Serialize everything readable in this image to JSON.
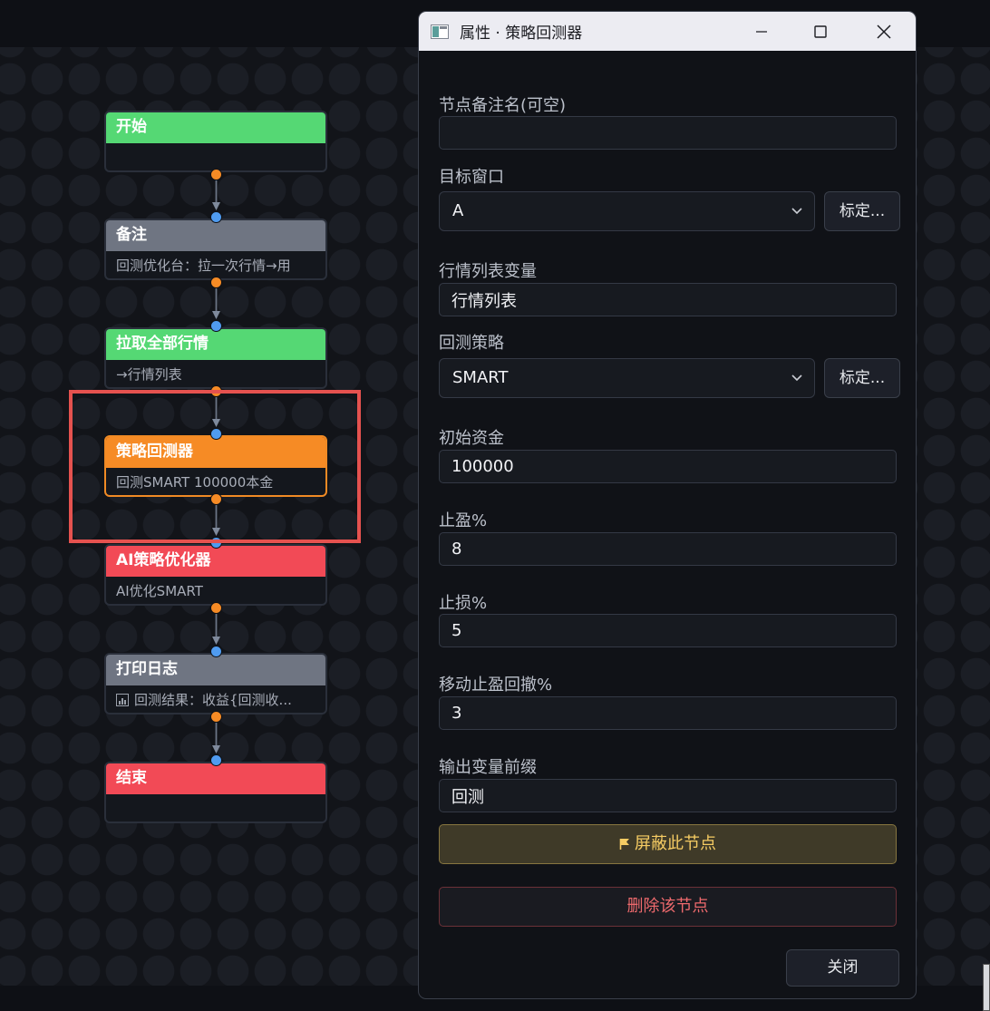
{
  "canvas": {
    "nodes": [
      {
        "title": "开始",
        "subtitle": "",
        "header_color": "#55d874"
      },
      {
        "title": "备注",
        "subtitle": "回测优化台：拉一次行情→用",
        "header_color": "#6f7582"
      },
      {
        "title": "拉取全部行情",
        "subtitle": "→行情列表",
        "header_color": "#55d874"
      },
      {
        "title": "策略回测器",
        "subtitle": "回测SMART 100000本金",
        "header_color": "#f68b25",
        "selected": true
      },
      {
        "title": "AI策略优化器",
        "subtitle": "AI优化SMART",
        "header_color": "#f24a56"
      },
      {
        "title": "打印日志",
        "subtitle": "回测结果：收益{回测收...",
        "subtitle_icon": "bar-chart-icon",
        "header_color": "#6f7582"
      },
      {
        "title": "结束",
        "subtitle": "",
        "header_color": "#f24a56"
      }
    ],
    "colors": {
      "out_port": "#f68b25",
      "in_port": "#4f9bf0",
      "highlight": "#e5524f"
    }
  },
  "dialog": {
    "title": "属性 · 策略回测器",
    "fields": {
      "note_label": "节点备注名(可空)",
      "note_value": "",
      "target_window_label": "目标窗口",
      "target_window_value": "A",
      "target_window_button": "标定...",
      "market_var_label": "行情列表变量",
      "market_var_value": "行情列表",
      "strategy_label": "回测策略",
      "strategy_value": "SMART",
      "strategy_button": "标定...",
      "capital_label": "初始资金",
      "capital_value": "100000",
      "take_profit_label": "止盈%",
      "take_profit_value": "8",
      "stop_loss_label": "止损%",
      "stop_loss_value": "5",
      "trailing_label": "移动止盈回撤%",
      "trailing_value": "3",
      "prefix_label": "输出变量前缀",
      "prefix_value": "回测"
    },
    "mask_button": "屏蔽此节点",
    "delete_button": "删除该节点",
    "close_button": "关闭",
    "colors": {
      "mask_text": "#f6cc63",
      "delete_text": "#ee6a6d"
    }
  }
}
